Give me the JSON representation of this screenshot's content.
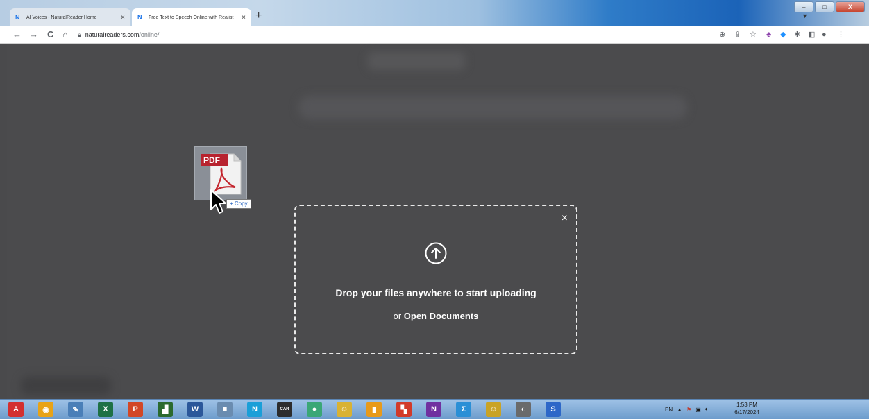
{
  "browser": {
    "tabs": [
      {
        "title": "AI Voices - NaturalReader Home",
        "favicon": "N",
        "active": false
      },
      {
        "title": "Free Text to Speech Online with Realist",
        "favicon": "N",
        "active": true
      }
    ],
    "new_tab": "+",
    "close_glyph": "×",
    "url_host": "naturalreaders.com",
    "url_path": "/online/",
    "nav": {
      "back": "←",
      "forward": "→",
      "reload": "C",
      "home": "⌂"
    },
    "window_controls": {
      "minimize": "–",
      "maximize": "□",
      "close": "X"
    }
  },
  "dropzone": {
    "close": "×",
    "message": "Drop your files anywhere to start uploading",
    "or": "or ",
    "open_link": "Open Documents"
  },
  "drag": {
    "file_label": "PDF",
    "tooltip": "+ Copy"
  },
  "taskbar": {
    "apps": [
      {
        "icon": "adobe-acrobat-icon",
        "glyph": "A",
        "color": "#d32f2f"
      },
      {
        "icon": "chrome-icon",
        "glyph": "◉",
        "color": "#e8a317"
      },
      {
        "icon": "notes-icon",
        "glyph": "✎",
        "color": "#4a7fb8"
      },
      {
        "icon": "excel-icon",
        "glyph": "X",
        "color": "#1e7145"
      },
      {
        "icon": "powerpoint-icon",
        "glyph": "P",
        "color": "#d24726"
      },
      {
        "icon": "paint-icon",
        "glyph": "▟",
        "color": "#2b6a2e"
      },
      {
        "icon": "word-icon",
        "glyph": "W",
        "color": "#2b579a"
      },
      {
        "icon": "app-grid-icon",
        "glyph": "■",
        "color": "#6a8cb0"
      },
      {
        "icon": "naturalreader-icon",
        "glyph": "N",
        "color": "#1a9fd8"
      },
      {
        "icon": "car-icon",
        "glyph": "CAR",
        "color": "#2d2d2d"
      },
      {
        "icon": "game-icon",
        "glyph": "●",
        "color": "#3aa776"
      },
      {
        "icon": "smiley-icon",
        "glyph": "☺",
        "color": "#d9b233"
      },
      {
        "icon": "usb-drive-icon",
        "glyph": "▮",
        "color": "#e89a1a"
      },
      {
        "icon": "photo-editor-icon",
        "glyph": "▚",
        "color": "#d23a2a"
      },
      {
        "icon": "onenote-icon",
        "glyph": "N",
        "color": "#7030a0"
      },
      {
        "icon": "sigma-icon",
        "glyph": "Σ",
        "color": "#2a8fd6"
      },
      {
        "icon": "smiley-2-icon",
        "glyph": "☺",
        "color": "#c9a326"
      },
      {
        "icon": "camera-icon",
        "glyph": "◐",
        "color": "#6a6a6a"
      },
      {
        "icon": "swirl-icon",
        "glyph": "S",
        "color": "#2d67c8"
      }
    ],
    "language": "EN",
    "tray_up": "▲",
    "time": "1:53 PM",
    "date": "6/17/2024"
  }
}
